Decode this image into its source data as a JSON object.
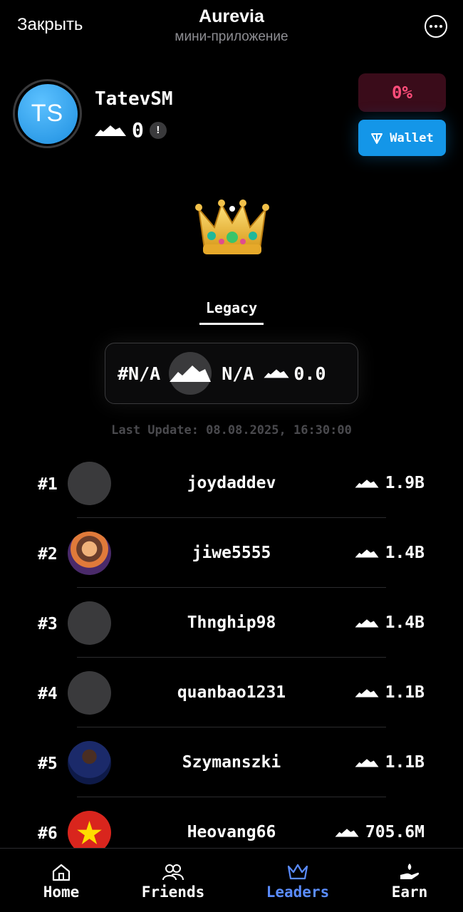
{
  "topbar": {
    "close_label": "Закрыть",
    "title": "Aurevia",
    "subtitle": "мини-приложение",
    "more_icon": "more-horizontal-icon"
  },
  "profile": {
    "initials": "TS",
    "username": "TatevSM",
    "balance": "0",
    "info_badge": "!",
    "avatar_color": "#2ea6f5"
  },
  "progress_percent": "0%",
  "wallet": {
    "label": "Wallet",
    "icon": "ton-icon"
  },
  "crown_icon": "crown-icon",
  "tabs": [
    {
      "label": "Legacy",
      "active": true
    }
  ],
  "my_rank": {
    "position": "#N/A",
    "name": "N/A",
    "score": "0.0"
  },
  "last_update": "Last Update: 08.08.2025, 16:30:00",
  "leaderboard": [
    {
      "rank": "#1",
      "name": "joydaddev",
      "score": "1.9B",
      "avatar": "blank"
    },
    {
      "rank": "#2",
      "name": "jiwe5555",
      "score": "1.4B",
      "avatar": "anime-character"
    },
    {
      "rank": "#3",
      "name": "Thnghip98",
      "score": "1.4B",
      "avatar": "blank"
    },
    {
      "rank": "#4",
      "name": "quanbao1231",
      "score": "1.1B",
      "avatar": "blank"
    },
    {
      "rank": "#5",
      "name": "Szymanszki",
      "score": "1.1B",
      "avatar": "person-photo"
    },
    {
      "rank": "#6",
      "name": "Heovang66",
      "score": "705.6M",
      "avatar": "vietnam-flag"
    }
  ],
  "nav": [
    {
      "label": "Home",
      "icon": "home-icon",
      "active": false
    },
    {
      "label": "Friends",
      "icon": "friends-icon",
      "active": false
    },
    {
      "label": "Leaders",
      "icon": "crown-icon",
      "active": true
    },
    {
      "label": "Earn",
      "icon": "earn-icon",
      "active": false
    }
  ],
  "colors": {
    "accent": "#1496e8",
    "nav_active": "#5a8cff",
    "percent_text": "#ff4d7a",
    "percent_bg": "#3a0c1a"
  }
}
